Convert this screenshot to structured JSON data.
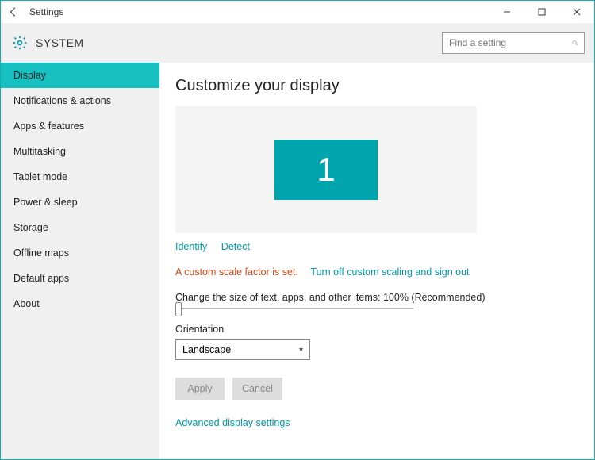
{
  "window": {
    "title": "Settings",
    "section": "SYSTEM"
  },
  "search": {
    "placeholder": "Find a setting"
  },
  "sidebar": {
    "items": [
      {
        "label": "Display",
        "active": true
      },
      {
        "label": "Notifications & actions"
      },
      {
        "label": "Apps & features"
      },
      {
        "label": "Multitasking"
      },
      {
        "label": "Tablet mode"
      },
      {
        "label": "Power & sleep"
      },
      {
        "label": "Storage"
      },
      {
        "label": "Offline maps"
      },
      {
        "label": "Default apps"
      },
      {
        "label": "About"
      }
    ]
  },
  "main": {
    "heading": "Customize your display",
    "monitor_label": "1",
    "identify": "Identify",
    "detect": "Detect",
    "warning": "A custom scale factor is set.",
    "turnoff": "Turn off custom scaling and sign out",
    "size_label": "Change the size of text, apps, and other items: 100% (Recommended)",
    "orientation_label": "Orientation",
    "orientation_value": "Landscape",
    "apply": "Apply",
    "cancel": "Cancel",
    "advanced": "Advanced display settings"
  }
}
